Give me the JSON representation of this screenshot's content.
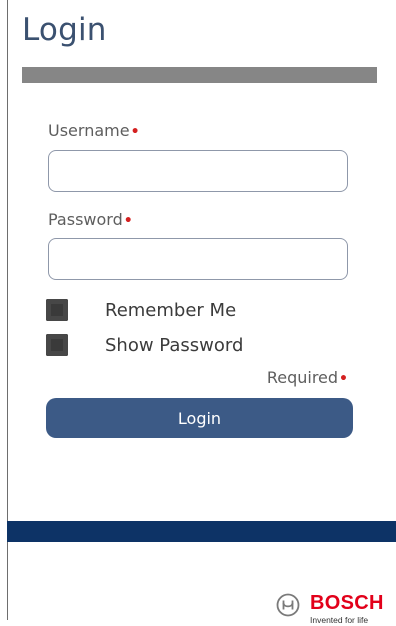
{
  "page": {
    "title": "Login"
  },
  "form": {
    "username": {
      "label": "Username",
      "required_mark": "•",
      "value": "",
      "placeholder": ""
    },
    "password": {
      "label": "Password",
      "required_mark": "•",
      "value": "",
      "placeholder": ""
    },
    "remember_me": {
      "label": "Remember Me",
      "checked": false
    },
    "show_password": {
      "label": "Show Password",
      "checked": false
    },
    "required_note": {
      "label": "Required",
      "mark": "•"
    },
    "submit_label": "Login"
  },
  "footer": {
    "brand_name": "BOSCH",
    "tagline": "Invented for life",
    "brand_icon": "bosch-armature-icon"
  },
  "colors": {
    "title": "#3b5170",
    "required_mark": "#d42020",
    "button": "#3c5a86",
    "footer_band": "#0d3366",
    "brand_red": "#e2001a"
  }
}
